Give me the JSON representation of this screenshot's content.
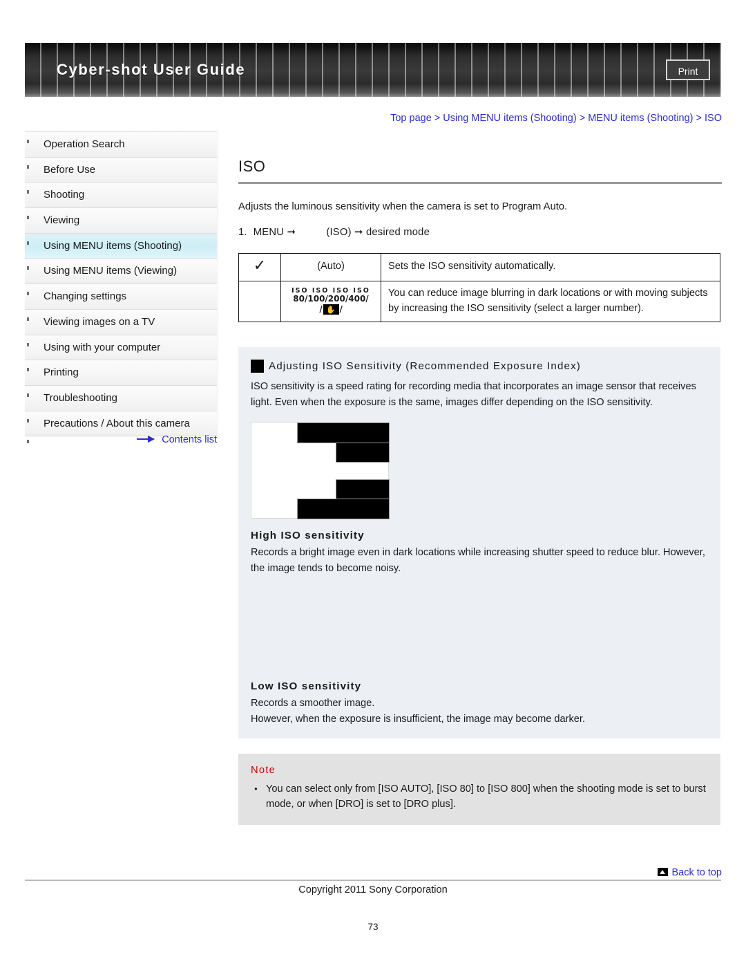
{
  "header": {
    "title": "Cyber-shot User Guide",
    "print_label": "Print"
  },
  "breadcrumb": {
    "full": "Top page > Using MENU items (Shooting) > MENU items (Shooting) > ISO",
    "items": [
      "Top page",
      "Using MENU items (Shooting)",
      "MENU items (Shooting)",
      "ISO"
    ]
  },
  "sidebar": {
    "items": [
      {
        "label": "Operation Search",
        "active": false
      },
      {
        "label": "Before Use",
        "active": false
      },
      {
        "label": "Shooting",
        "active": false
      },
      {
        "label": "Viewing",
        "active": false
      },
      {
        "label": "Using MENU items (Shooting)",
        "active": true
      },
      {
        "label": "Using MENU items (Viewing)",
        "active": false
      },
      {
        "label": "Changing settings",
        "active": false
      },
      {
        "label": "Viewing images on a TV",
        "active": false
      },
      {
        "label": "Using with your computer",
        "active": false
      },
      {
        "label": "Printing",
        "active": false
      },
      {
        "label": "Troubleshooting",
        "active": false
      },
      {
        "label": "Precautions / About this camera",
        "active": false
      }
    ],
    "contents_link": "Contents list"
  },
  "main": {
    "title": "ISO",
    "lead": "Adjusts the luminous sensitivity when the camera is set to Program Auto.",
    "step": {
      "number": "1.",
      "first": "MENU",
      "arrow": "➞",
      "second": "(ISO)",
      "third": "desired mode"
    },
    "table": {
      "rows": [
        {
          "checked": true,
          "icon_label": "(Auto)",
          "description": "Sets the ISO sensitivity automatically."
        },
        {
          "checked": false,
          "icon_iso_row1": "ISO  ISO  ISO  ISO",
          "icon_iso_row2": "80/100/200/400/",
          "icon_hand_prefix": "/",
          "icon_hand_suffix": "/",
          "description": "You can reduce image blurring in dark locations or with moving subjects by increasing the ISO sensitivity (select a larger number)."
        }
      ]
    },
    "panel": {
      "heading": "Adjusting ISO Sensitivity (Recommended Exposure Index)",
      "intro": "ISO sensitivity is a speed rating for recording media that incorporates an image sensor that receives light. Even when the exposure is the same, images differ depending on the ISO sensitivity.",
      "high": {
        "heading": "High ISO sensitivity",
        "body": "Records a bright image even in dark locations while increasing shutter speed to reduce blur. However, the image tends to become noisy."
      },
      "low": {
        "heading": "Low ISO sensitivity",
        "body_line1": "Records a smoother image.",
        "body_line2": "However, when the exposure is insufficient, the image may become darker."
      }
    },
    "note": {
      "title": "Note",
      "items": [
        "You can select only from [ISO AUTO], [ISO 80] to [ISO 800] when the shooting mode is set to burst mode, or when [DRO] is set to [DRO plus]."
      ]
    }
  },
  "footer": {
    "back_to_top": "Back to top",
    "copyright": "Copyright 2011 Sony Corporation",
    "page_number": "73"
  },
  "colors": {
    "link": "#2b2bcf",
    "note_title": "#cc0000",
    "panel_bg": "#eceff4",
    "note_bg": "#e2e2e2",
    "active_nav": "#cdeef6"
  }
}
